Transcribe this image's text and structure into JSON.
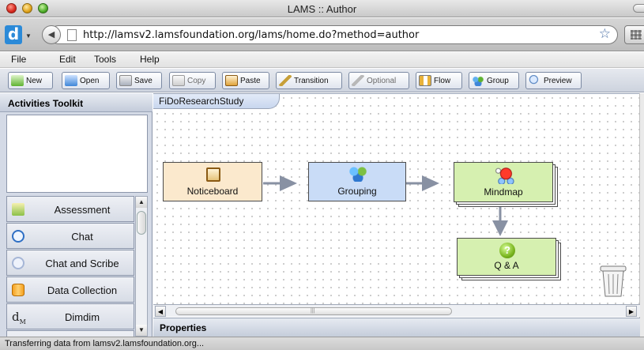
{
  "window": {
    "title": "LAMS :: Author"
  },
  "browser": {
    "url": "http://lamsv2.lamsfoundation.org/lams/home.do?method=author"
  },
  "menu": {
    "items": [
      "File",
      "Edit",
      "Tools",
      "Help"
    ]
  },
  "toolbar": {
    "buttons": [
      {
        "label": "New",
        "icon": "new-icon"
      },
      {
        "label": "Open",
        "icon": "folder-icon"
      },
      {
        "label": "Save",
        "icon": "save-icon"
      },
      {
        "label": "Copy",
        "icon": "copy-icon"
      },
      {
        "label": "Paste",
        "icon": "paste-icon"
      },
      {
        "label": "Transition",
        "icon": "pencil-icon"
      },
      {
        "label": "Optional",
        "icon": "pencil-icon"
      },
      {
        "label": "Flow",
        "icon": "flow-icon"
      },
      {
        "label": "Group",
        "icon": "group-icon"
      },
      {
        "label": "Preview",
        "icon": "magnifier-icon"
      }
    ]
  },
  "toolkit": {
    "title": "Activities Toolkit",
    "items": [
      {
        "label": "Assessment",
        "icon": "assessment-icon"
      },
      {
        "label": "Chat",
        "icon": "chat-bubble-icon"
      },
      {
        "label": "Chat and Scribe",
        "icon": "chat-scribe-icon"
      },
      {
        "label": "Data Collection",
        "icon": "database-icon"
      },
      {
        "label": "Dimdim",
        "icon": "dimdim-icon"
      }
    ]
  },
  "canvas": {
    "tab_label": "FiDoResearchStudy",
    "nodes": [
      {
        "label": "Noticeboard",
        "icon": "noticeboard-icon"
      },
      {
        "label": "Grouping",
        "icon": "group-icon"
      },
      {
        "label": "Mindmap",
        "icon": "mindmap-icon"
      },
      {
        "label": "Q & A",
        "icon": "question-icon"
      }
    ]
  },
  "properties": {
    "title": "Properties"
  },
  "status": {
    "text": "Transferring data from lamsv2.lamsfoundation.org..."
  },
  "colors": {
    "noticeboard_fill": "#fbe9cd",
    "grouping_fill": "#c9dcf7",
    "mindmap_fill": "#d6f0b0",
    "qa_fill": "#d6f0b0",
    "arrow": "#8891a3",
    "panel": "#d4dae6"
  }
}
